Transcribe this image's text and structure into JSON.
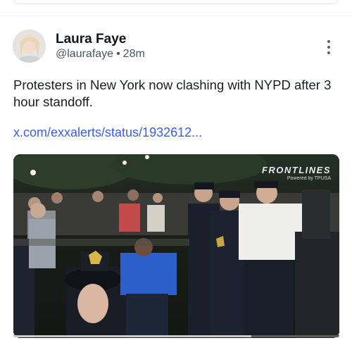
{
  "post": {
    "author_name": "Laura Faye",
    "handle": "@laurafaye",
    "separator": "•",
    "time": "28m",
    "text": "Protesters in New York now clashing with NYPD after 3 hour standoff.",
    "link": "x.com/exxalerts/status/1932612...",
    "media": {
      "watermark_title": "FRONTLINES",
      "watermark_sub": "Powered by TPUSA",
      "progress_fraction": 0.73
    }
  },
  "icons": {
    "more": "more-vertical-icon",
    "avatar": "avatar-photo"
  }
}
